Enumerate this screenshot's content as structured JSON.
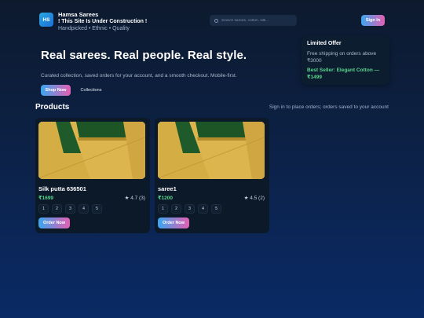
{
  "header": {
    "logo_text": "HS",
    "brand_name": "Hamsa Sarees",
    "notice": "! This Site Is Under Construction !",
    "tagline": "Handpicked • Ethnic • Quality",
    "search_placeholder": "Search sarees, cotton, silk...",
    "signin_label": "Sign In"
  },
  "hero": {
    "title": "Real sarees. Real people. Real style.",
    "subtitle": "Curated collection, saved orders for your account, and a smooth checkout. Mobile-first.",
    "shop_label": "Shop Now",
    "collections_label": "Collections"
  },
  "offer": {
    "title": "Limited Offer",
    "text": "Free shipping on orders above ₹3000",
    "best_seller": "Best Seller: Elegant Cotton — ₹1499"
  },
  "products": {
    "title": "Products",
    "note": "Sign in to place orders; orders saved to your account",
    "items": [
      {
        "name": "Silk putta 636501",
        "price": "₹1699",
        "rating": "★ 4.7 (3)",
        "pages": [
          "1",
          "2",
          "3",
          "4",
          "5"
        ],
        "order_label": "Order Now"
      },
      {
        "name": "saree1",
        "price": "₹1200",
        "rating": "★ 4.5 (2)",
        "pages": [
          "1",
          "2",
          "3",
          "4",
          "5"
        ],
        "order_label": "Order Now"
      }
    ]
  },
  "colors": {
    "accent_gradient_start": "#3aa6f0",
    "accent_gradient_end": "#e45fb2",
    "price_green": "#58d68d",
    "saree_gold": "#d9b24a",
    "saree_green": "#1f5a2a"
  }
}
